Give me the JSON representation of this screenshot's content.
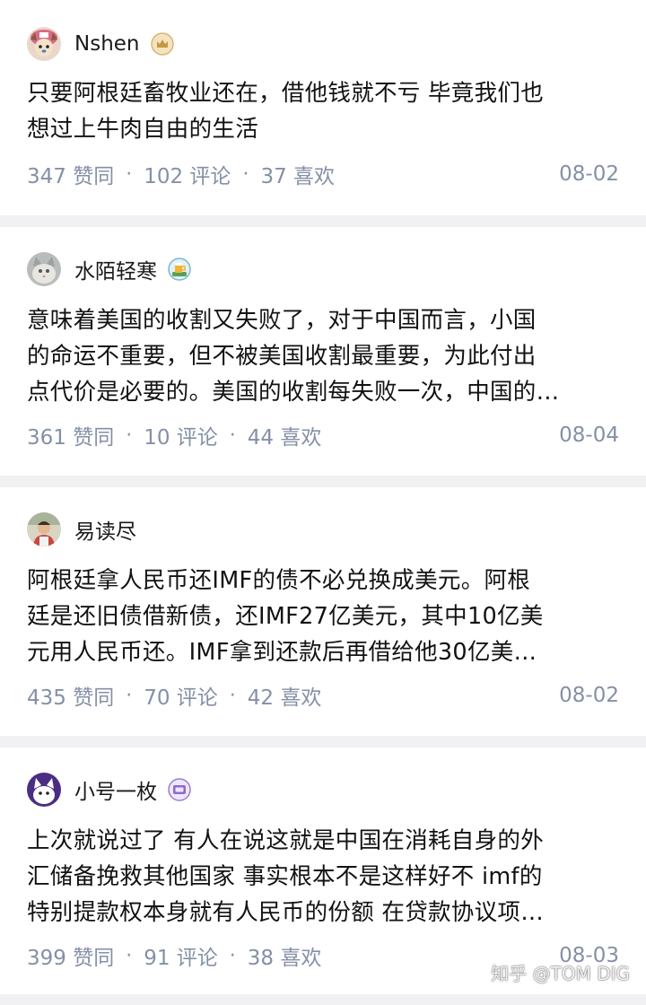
{
  "answers": [
    {
      "author": "Nshen",
      "badge": "crown-badge",
      "lines": [
        "只要阿根廷畜牧业还在，借他钱就不亏 毕竟我们也",
        "想过上牛肉自由的生活"
      ],
      "likes": "347 赞同",
      "comments": "102 评论",
      "favorites": "37 喜欢",
      "date": "08-02"
    },
    {
      "author": "水陌轻寒",
      "badge": "beer-badge",
      "lines": [
        "意味着美国的收割又失败了，对于中国而言，小国",
        "的命运不重要，但不被美国收割最重要，为此付出",
        "点代价是必要的。美国的收割每失败一次，中国的…"
      ],
      "likes": "361 赞同",
      "comments": "10 评论",
      "favorites": "44 喜欢",
      "date": "08-04"
    },
    {
      "author": "易读尽",
      "badge": "",
      "lines": [
        "阿根廷拿人民币还IMF的债不必兑换成美元。阿根",
        "廷是还旧债借新债，还IMF27亿美元，其中10亿美",
        "元用人民币还。IMF拿到还款后再借给他30亿美…"
      ],
      "likes": "435 赞同",
      "comments": "70 评论",
      "favorites": "42 喜欢",
      "date": "08-02"
    },
    {
      "author": "小号一枚",
      "badge": "screen-badge",
      "lines": [
        "上次就说过了 有人在说这就是中国在消耗自身的外",
        "汇储备挽救其他国家 事实根本不是这样好不 imf的",
        "特别提款权本身就有人民币的份额 在贷款协议项…"
      ],
      "likes": "399 赞同",
      "comments": "91 评论",
      "favorites": "38 喜欢",
      "date": "08-03"
    }
  ],
  "separator": "·",
  "watermark": "知乎 @TOM DIG",
  "colors": {
    "background": "#f1f1f3",
    "card": "#ffffff",
    "meta_text": "#8590a6",
    "body_text": "#121212"
  }
}
